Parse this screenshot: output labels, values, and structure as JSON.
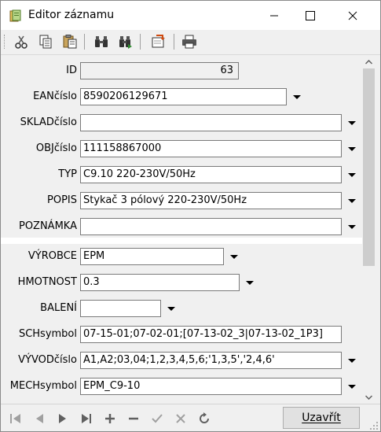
{
  "window": {
    "title": "Editor záznamu"
  },
  "toolbar": {
    "buttons": [
      "cut-icon",
      "copy-icon",
      "paste-icon",
      "find-icon",
      "find-next-icon",
      "import-icon",
      "print-icon"
    ]
  },
  "fields": [
    {
      "key": "id",
      "label": "ID",
      "value": "63"
    },
    {
      "key": "ean",
      "label": "EANčíslo",
      "value": "8590206129671"
    },
    {
      "key": "sklad",
      "label": "SKLADčíslo",
      "value": ""
    },
    {
      "key": "obj",
      "label": "OBJčíslo",
      "value": "111158867000"
    },
    {
      "key": "typ",
      "label": "TYP",
      "value": "C9.10 220-230V/50Hz"
    },
    {
      "key": "popis",
      "label": "POPIS",
      "value": "Stykač 3 pólový 220-230V/50Hz"
    },
    {
      "key": "poznamka",
      "label": "POZNÁMKA",
      "value": ""
    },
    {
      "key": "vyrobce",
      "label": "VÝROBCE",
      "value": "EPM"
    },
    {
      "key": "hmotnost",
      "label": "HMOTNOST",
      "value": "0.3"
    },
    {
      "key": "baleni",
      "label": "BALENÍ",
      "value": ""
    },
    {
      "key": "schsymbol",
      "label": "SCHsymbol",
      "value": "07-15-01;07-02-01;[07-13-02_3|07-13-02_1P3]"
    },
    {
      "key": "vyvodcislo",
      "label": "VÝVODčíslo",
      "value": "A1,A2;03,04;1,2,3,4,5,6;'1,3,5','2,4,6'"
    },
    {
      "key": "mechsymbol",
      "label": "MECHsymbol",
      "value": "EPM_C9-10"
    }
  ],
  "footer": {
    "close_label": "Uzavřít",
    "nav": [
      "first-record-icon",
      "prev-record-icon",
      "next-record-icon",
      "last-record-icon",
      "add-record-icon",
      "delete-record-icon",
      "confirm-icon",
      "cancel-edit-icon",
      "refresh-icon"
    ]
  },
  "colors": {
    "accent": "#2b7bd3",
    "disabled": "#a0a0a0"
  }
}
